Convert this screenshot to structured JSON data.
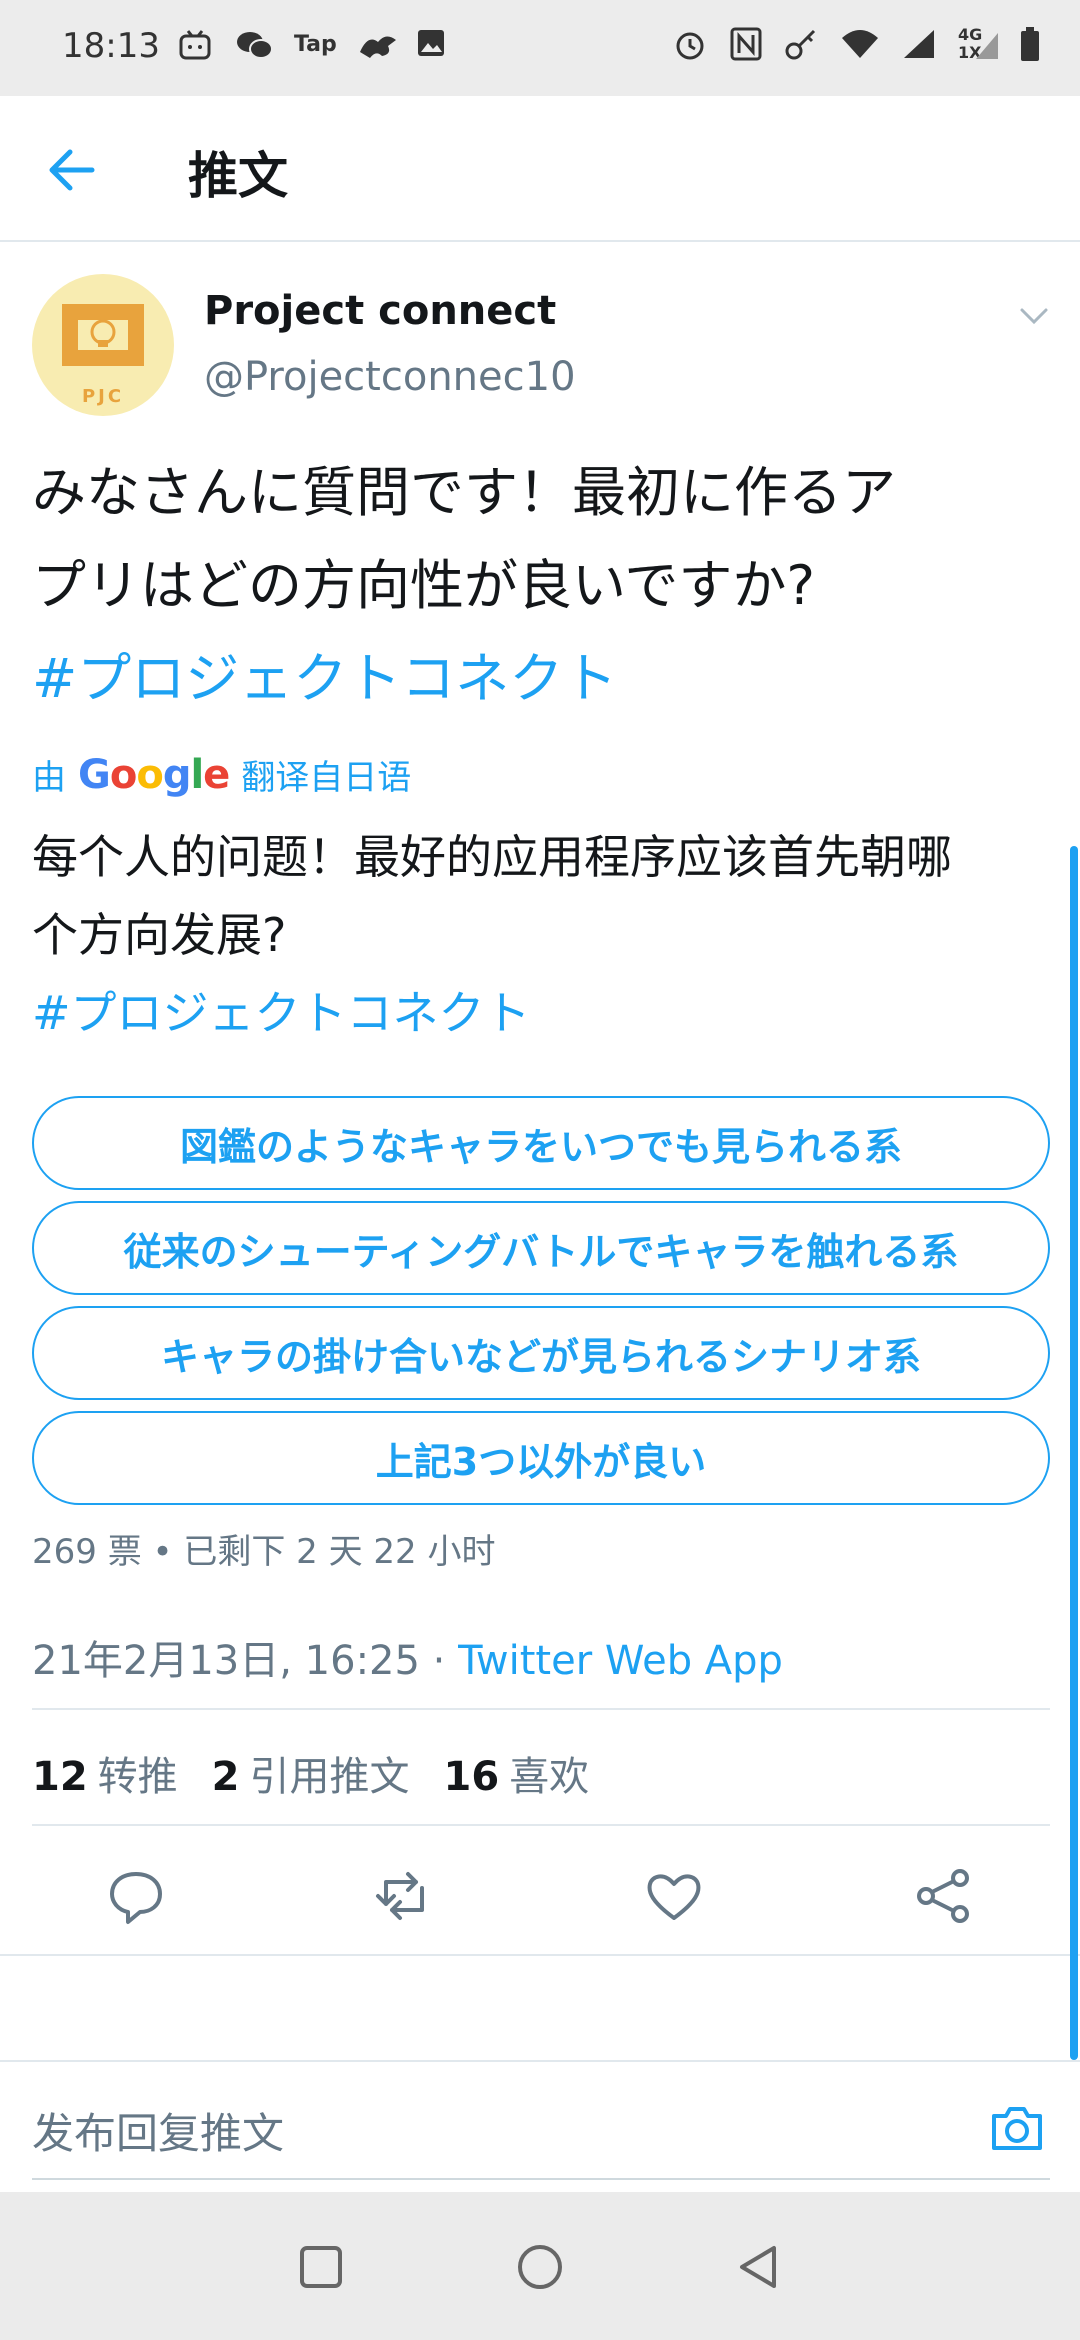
{
  "status_bar": {
    "time": "18:13",
    "left_icons": [
      "bilibili-icon",
      "wechat-icon",
      "taptap-icon",
      "dragon-app-icon",
      "gallery-icon"
    ],
    "taptap_label": "Tap",
    "right_icons": [
      "alarm-icon",
      "nfc-icon",
      "key-icon",
      "wifi-icon",
      "signal-icon",
      "signal-4g-icon",
      "battery-icon"
    ],
    "network_label_top": "4G",
    "network_label_bottom": "1X"
  },
  "header": {
    "title": "推文",
    "back_icon": "arrow-left-icon"
  },
  "tweet": {
    "avatar_text": "PJC",
    "author_name": "Project connect",
    "author_handle": "@Projectconnec10",
    "text_line1": "みなさんに質問です！最初に作るア",
    "text_line2": "プリはどの方向性が良いですか?",
    "hashtag": "#プロジェクトコネクト",
    "translate_prefix": "由",
    "translate_brand": "Google",
    "translate_suffix": "翻译自日语",
    "translated_line1": "每个人的问题！最好的应用程序应该首先朝哪",
    "translated_line2": "个方向发展?",
    "translated_hashtag": "#プロジェクトコネクト",
    "poll_options": [
      "図鑑のようなキャラをいつでも見られる系",
      "従来のシューティングバトルでキャラを触れる系",
      "キャラの掛け合いなどが見られるシナリオ系",
      "上記3つ以外が良い"
    ],
    "poll_meta": "269 票 • 已剩下 2 天 22 小时",
    "timestamp": "21年2月13日, 16:25 · ",
    "source_app": "Twitter Web App",
    "retweets_count": "12",
    "retweets_label": "转推",
    "quotes_count": "2",
    "quotes_label": "引用推文",
    "likes_count": "16",
    "likes_label": "喜欢"
  },
  "reply": {
    "placeholder": "发布回复推文"
  },
  "colors": {
    "accent": "#1da1f2",
    "secondary_text": "#657786",
    "avatar_bg": "#f8ecb1",
    "avatar_orange": "#e8a33d"
  }
}
